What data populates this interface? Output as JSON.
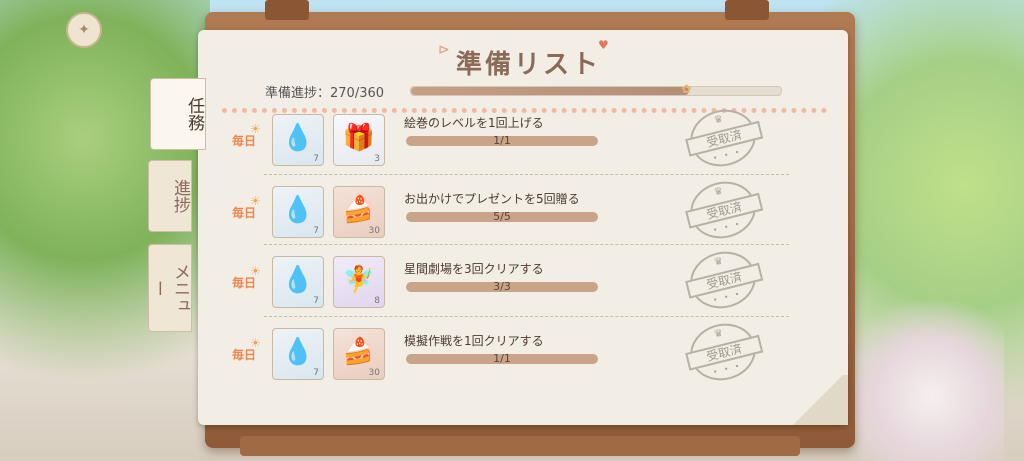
{
  "panel": {
    "title": "準備リスト"
  },
  "overall_progress": {
    "label": "準備進捗：270/360",
    "current": 270,
    "total": 360
  },
  "tabs": [
    {
      "label": "任務",
      "active": true
    },
    {
      "label": "進捗",
      "active": false
    },
    {
      "label": "メニュー",
      "active": false
    }
  ],
  "tasks": [
    {
      "tag": "毎日",
      "text": "絵巻のレベルを1回上げる",
      "progress": "1/1",
      "status": "受取済",
      "rewards": [
        {
          "icon": "crystal-bottle-icon",
          "count": "7"
        },
        {
          "icon": "gift-box-icon",
          "count": "3"
        }
      ]
    },
    {
      "tag": "毎日",
      "text": "お出かけでプレゼントを5回贈る",
      "progress": "5/5",
      "status": "受取済",
      "rewards": [
        {
          "icon": "crystal-bottle-icon",
          "count": "7"
        },
        {
          "icon": "strawberry-cake-icon",
          "count": "30"
        }
      ]
    },
    {
      "tag": "毎日",
      "text": "星間劇場を3回クリアする",
      "progress": "3/3",
      "status": "受取済",
      "rewards": [
        {
          "icon": "crystal-bottle-icon",
          "count": "7"
        },
        {
          "icon": "fairy-figure-icon",
          "count": "8"
        }
      ]
    },
    {
      "tag": "毎日",
      "text": "模擬作戦を1回クリアする",
      "progress": "1/1",
      "status": "受取済",
      "rewards": [
        {
          "icon": "crystal-bottle-icon",
          "count": "7"
        },
        {
          "icon": "strawberry-cake-icon",
          "count": "30"
        }
      ]
    }
  ]
}
